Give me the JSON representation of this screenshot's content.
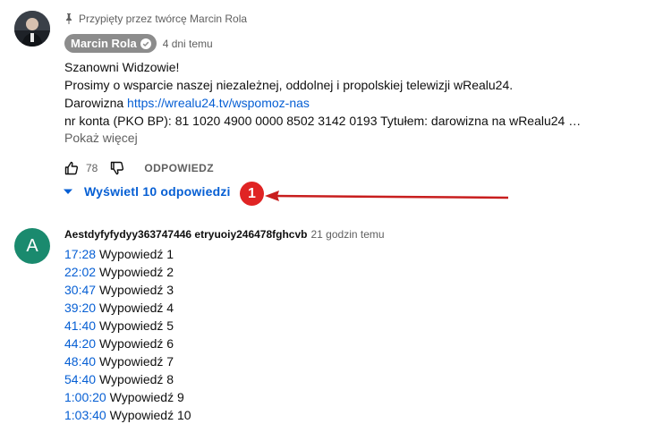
{
  "pinned": {
    "text": "Przypięty przez twórcę Marcin Rola"
  },
  "comment1": {
    "author": "Marcin Rola",
    "time": "4 dni temu",
    "lines": {
      "l1": "Szanowni Widzowie!",
      "l2": "Prosimy  o wsparcie naszej niezależnej, oddolnej i propolskiej telewizji wRealu24.",
      "l3_prefix": "Darowizna ",
      "l3_link": "https://wrealu24.tv/wspomoz-nas",
      "l4": "nr konta (PKO BP): 81 1020 4900 0000 8502 3142 0193  Tytułem: darowizna na wRealu24 …"
    },
    "more": "Pokaż więcej",
    "likes": "78",
    "reply": "ODPOWIEDZ",
    "replies_toggle": "Wyświetl 10 odpowiedzi"
  },
  "annotation": {
    "badge": "1",
    "badge_color": "#e02424"
  },
  "comment2": {
    "avatar_letter": "A",
    "avatar_color": "#1a8a6e",
    "author": "Aestdyfyfydyy363747446 etryuoiy246478fghcvb",
    "time": "21 godzin temu",
    "items": [
      {
        "ts": "17:28",
        "label": "Wypowiedź 1"
      },
      {
        "ts": "22:02",
        "label": "Wypowiedź 2"
      },
      {
        "ts": "30:47",
        "label": "Wypowiedź 3"
      },
      {
        "ts": "39:20",
        "label": "Wypowiedź 4"
      },
      {
        "ts": "41:40",
        "label": "Wypowiedź 5"
      },
      {
        "ts": "44:20",
        "label": "Wypowiedź 6"
      },
      {
        "ts": "48:40",
        "label": "Wypowiedź 7"
      },
      {
        "ts": "54:40",
        "label": "Wypowiedź 8"
      },
      {
        "ts": "1:00:20",
        "label": "Wypowiedź 9"
      },
      {
        "ts": "1:03:40",
        "label": "Wypowiedź 10"
      }
    ]
  },
  "colors": {
    "link": "#065fd4",
    "muted": "#606060",
    "author_chip": "#8c8c8c"
  }
}
